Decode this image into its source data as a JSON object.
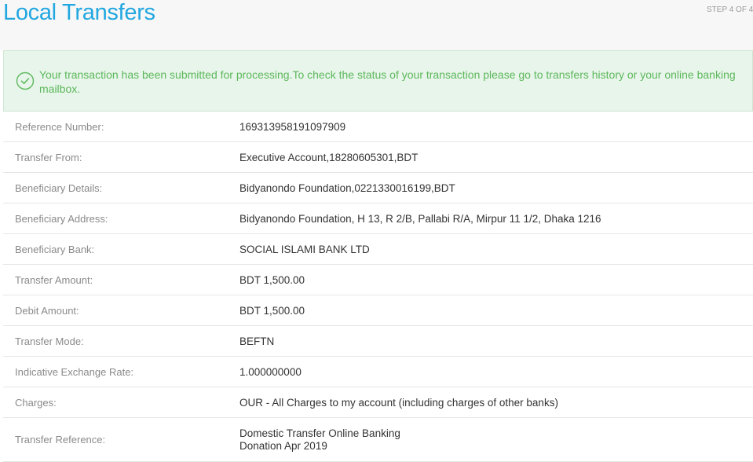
{
  "header": {
    "title": "Local Transfers",
    "step": "STEP 4 OF 4"
  },
  "alert": {
    "message": "Your transaction has been submitted for processing.To check the status of your transaction please go to transfers history or your online banking mailbox.",
    "icon": "check-circle-icon",
    "color": "#5cb85c"
  },
  "details": [
    {
      "label": "Reference Number:",
      "value": "169313958191097909"
    },
    {
      "label": "Transfer From:",
      "value": "Executive Account,18280605301,BDT"
    },
    {
      "label": "Beneficiary Details:",
      "value": "Bidyanondo Foundation,0221330016199,BDT"
    },
    {
      "label": "Beneficiary Address:",
      "value": "Bidyanondo Foundation, H 13, R 2/B, Pallabi R/A, Mirpur 11 1/2, Dhaka 1216"
    },
    {
      "label": "Beneficiary Bank:",
      "value": "SOCIAL ISLAMI BANK LTD"
    },
    {
      "label": "Transfer Amount:",
      "value": "BDT 1,500.00"
    },
    {
      "label": "Debit Amount:",
      "value": "BDT 1,500.00"
    },
    {
      "label": "Transfer Mode:",
      "value": "BEFTN"
    },
    {
      "label": "Indicative Exchange Rate:",
      "value": "1.000000000"
    },
    {
      "label": "Charges:",
      "value": "OUR - All Charges to my account (including charges of other banks)"
    },
    {
      "label": "Transfer Reference:",
      "value_line1": "Domestic Transfer Online Banking",
      "value_line2": "Donation Apr 2019"
    }
  ]
}
